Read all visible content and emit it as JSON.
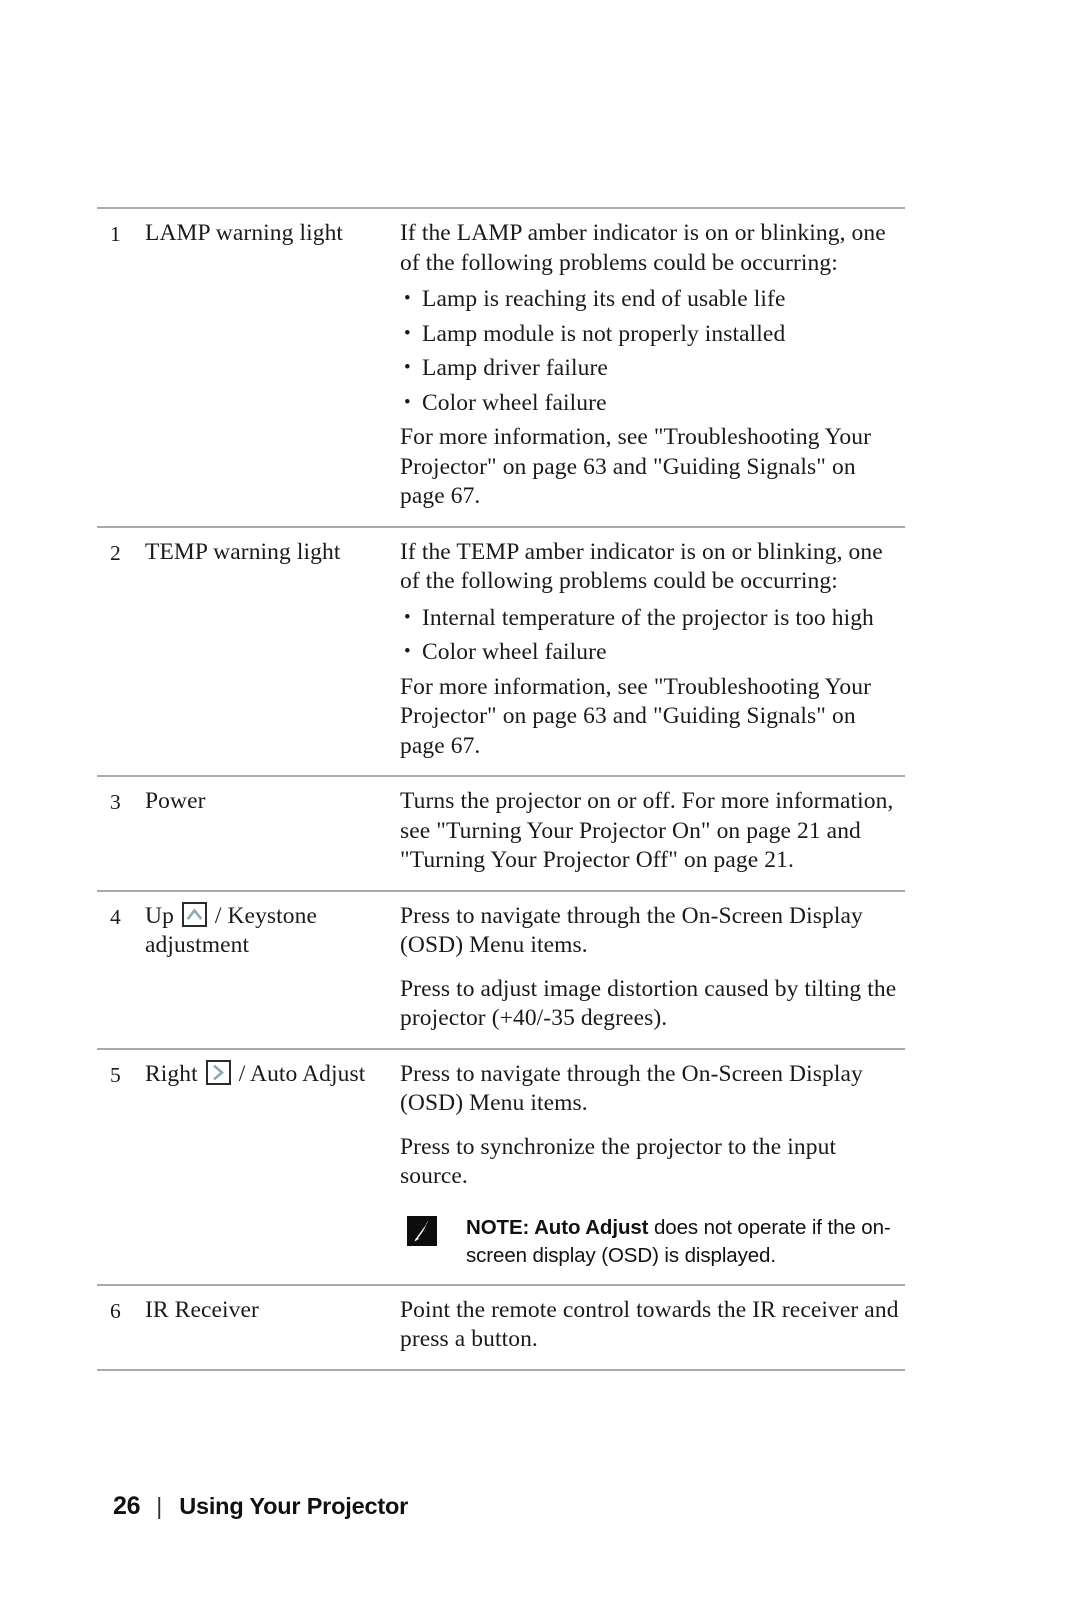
{
  "document": {
    "page_number": "26",
    "footer_separator": "|",
    "footer_title": "Using Your Projector",
    "rule_color": "#a9a9a9"
  },
  "table": {
    "rows": [
      {
        "num": "1",
        "name": "LAMP warning light",
        "icon": null,
        "blocks": [
          {
            "type": "para",
            "text": "If the LAMP amber indicator is on or blinking, one of the following problems could be occurring:"
          },
          {
            "type": "bullets",
            "items": [
              "Lamp is reaching its end of usable life",
              "Lamp module is not properly installed",
              "Lamp driver failure",
              "Color wheel failure"
            ]
          },
          {
            "type": "para",
            "text": "For more information, see \"Troubleshooting Your Projector\" on page 63 and \"Guiding Signals\" on page 67."
          }
        ]
      },
      {
        "num": "2",
        "name": "TEMP warning light",
        "icon": null,
        "blocks": [
          {
            "type": "para",
            "text": "If the TEMP amber indicator is on or blinking, one of the following problems could be occurring:"
          },
          {
            "type": "bullets",
            "items": [
              "Internal temperature of the projector is too high",
              "Color wheel failure"
            ]
          },
          {
            "type": "para",
            "text": "For more information, see \"Troubleshooting Your Projector\" on page 63 and \"Guiding Signals\" on page 67."
          }
        ]
      },
      {
        "num": "3",
        "name": "Power",
        "icon": null,
        "blocks": [
          {
            "type": "para",
            "text": "Turns the projector on or off. For more information, see \"Turning Your Projector On\" on page 21 and \"Turning Your Projector Off\" on page 21."
          }
        ]
      },
      {
        "num": "4",
        "name_before": "Up ",
        "name_after": " / Keystone adjustment",
        "icon": "up-arrow-key-icon",
        "blocks": [
          {
            "type": "para",
            "text": "Press to navigate through the On-Screen Display (OSD) Menu items."
          },
          {
            "type": "para",
            "text": "Press to adjust image distortion caused by tilting the projector (+40/-35 degrees)."
          }
        ]
      },
      {
        "num": "5",
        "name_before": "Right ",
        "name_after": " / Auto Adjust",
        "icon": "right-arrow-key-icon",
        "blocks": [
          {
            "type": "para",
            "text": "Press to navigate through the On-Screen Display (OSD) Menu items."
          },
          {
            "type": "para",
            "text": "Press to synchronize the projector to the input source."
          },
          {
            "type": "note",
            "icon": "note-pencil-icon",
            "label": "NOTE: Auto Adjust",
            "text": " does not operate if the on-screen display (OSD) is displayed."
          }
        ]
      },
      {
        "num": "6",
        "name": "IR Receiver",
        "icon": null,
        "blocks": [
          {
            "type": "para",
            "text": "Point the remote control towards the IR receiver and press a button."
          }
        ]
      }
    ]
  },
  "icons": {
    "up_arrow_color": "#8fa9b4",
    "right_arrow_color": "#8fa9b4",
    "key_border_color": "#2b2b2b",
    "note_icon_bg": "#0d0d0d"
  }
}
